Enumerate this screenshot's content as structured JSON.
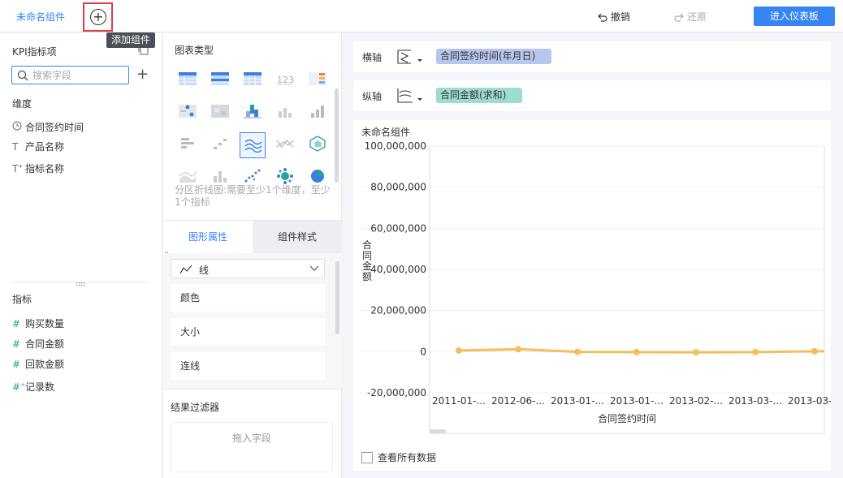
{
  "topbar": {
    "component_tab": "未命名组件",
    "add_tooltip": "添加组件",
    "undo_label": "撤销",
    "redo_label": "还原",
    "enter_dashboard": "进入仪表板"
  },
  "left_panel": {
    "kpi_title": "KPI指标项",
    "search_placeholder": "搜索字段",
    "dimension_label": "维度",
    "dimensions": [
      {
        "label": "合同签约时间",
        "icon": "clock-icon"
      },
      {
        "label": "产品名称",
        "icon": "text-icon"
      },
      {
        "label": "指标名称",
        "icon": "text-plus-icon"
      }
    ],
    "metric_label": "指标",
    "metrics": [
      {
        "label": "购买数量",
        "icon": "hash-icon"
      },
      {
        "label": "合同金额",
        "icon": "hash-icon"
      },
      {
        "label": "回款金额",
        "icon": "hash-icon"
      },
      {
        "label": "记录数",
        "icon": "hash-plus-icon"
      }
    ]
  },
  "mid_panel": {
    "chart_type_title": "图表类型",
    "chart_desc": "分区折线图:需要至少1个维度，至少1个指标",
    "tab_shape": "图形属性",
    "tab_style": "组件样式",
    "line_type": "线",
    "attr_color": "颜色",
    "attr_size": "大小",
    "attr_connect": "连线",
    "filter_title": "结果过滤器",
    "drop_zone": "拖入字段"
  },
  "axes": {
    "x_label": "横轴",
    "x_field": "合同签约时间(年月日)",
    "y_label": "纵轴",
    "y_field": "合同金额(求和)"
  },
  "chart": {
    "title": "未命名组件",
    "view_all": "查看所有数据"
  },
  "chart_data": {
    "type": "line",
    "title": "未命名组件",
    "xlabel": "合同签约时间",
    "ylabel": "合同金额",
    "categories": [
      "2011-01-...",
      "2012-06-...",
      "2013-01-...",
      "2013-01-...",
      "2013-02-...",
      "2013-03-...",
      "2013-03-..."
    ],
    "values": [
      600000,
      1200000,
      -100000,
      -200000,
      -300000,
      -200000,
      200000
    ],
    "ylim": [
      -20000000,
      100000000
    ],
    "yticks": [
      "100,000,000",
      "80,000,000",
      "60,000,000",
      "40,000,000",
      "20,000,000",
      "0",
      "-20,000,000"
    ],
    "color": "#f6bd5c"
  }
}
